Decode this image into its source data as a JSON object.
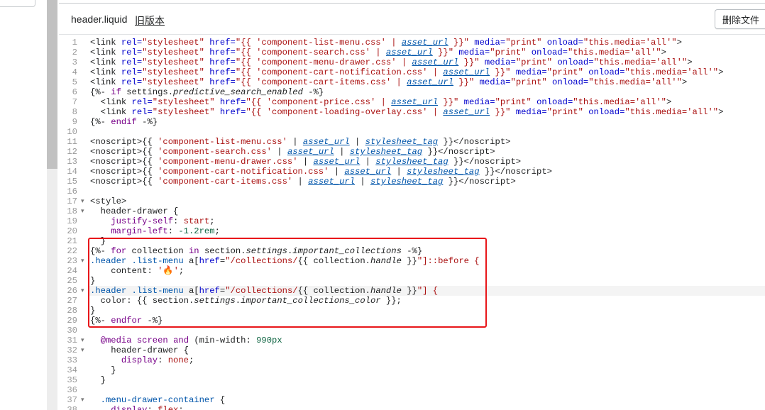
{
  "editor": {
    "file_name": "header.liquid",
    "old_version_link": "旧版本",
    "delete_button": "删除文件",
    "active_line": 26,
    "code_lines": [
      {
        "n": "1",
        "fold": "",
        "segs": [
          [
            "",
            "<link "
          ],
          [
            "t-attr",
            "rel="
          ],
          [
            "t-str",
            "\"stylesheet\""
          ],
          [
            "",
            " "
          ],
          [
            "t-attr",
            "href="
          ],
          [
            "t-str",
            "\"{{ 'component-list-menu.css' | "
          ],
          [
            "t-filter",
            "asset_url"
          ],
          [
            "t-str",
            " }}\""
          ],
          [
            "",
            " "
          ],
          [
            "t-attr",
            "media="
          ],
          [
            "t-str",
            "\"print\""
          ],
          [
            "",
            " "
          ],
          [
            "t-attr",
            "onload="
          ],
          [
            "t-str",
            "\"this.media='all'\""
          ],
          [
            "",
            ">"
          ]
        ]
      },
      {
        "n": "2",
        "fold": "",
        "segs": [
          [
            "",
            "<link "
          ],
          [
            "t-attr",
            "rel="
          ],
          [
            "t-str",
            "\"stylesheet\""
          ],
          [
            "",
            " "
          ],
          [
            "t-attr",
            "href="
          ],
          [
            "t-str",
            "\"{{ 'component-search.css' | "
          ],
          [
            "t-filter",
            "asset_url"
          ],
          [
            "t-str",
            " }}\""
          ],
          [
            "",
            " "
          ],
          [
            "t-attr",
            "media="
          ],
          [
            "t-str",
            "\"print\""
          ],
          [
            "",
            " "
          ],
          [
            "t-attr",
            "onload="
          ],
          [
            "t-str",
            "\"this.media='all'\""
          ],
          [
            "",
            ">"
          ]
        ]
      },
      {
        "n": "3",
        "fold": "",
        "segs": [
          [
            "",
            "<link "
          ],
          [
            "t-attr",
            "rel="
          ],
          [
            "t-str",
            "\"stylesheet\""
          ],
          [
            "",
            " "
          ],
          [
            "t-attr",
            "href="
          ],
          [
            "t-str",
            "\"{{ 'component-menu-drawer.css' | "
          ],
          [
            "t-filter",
            "asset_url"
          ],
          [
            "t-str",
            " }}\""
          ],
          [
            "",
            " "
          ],
          [
            "t-attr",
            "media="
          ],
          [
            "t-str",
            "\"print\""
          ],
          [
            "",
            " "
          ],
          [
            "t-attr",
            "onload="
          ],
          [
            "t-str",
            "\"this.media='all'\""
          ],
          [
            "",
            ">"
          ]
        ]
      },
      {
        "n": "4",
        "fold": "",
        "segs": [
          [
            "",
            "<link "
          ],
          [
            "t-attr",
            "rel="
          ],
          [
            "t-str",
            "\"stylesheet\""
          ],
          [
            "",
            " "
          ],
          [
            "t-attr",
            "href="
          ],
          [
            "t-str",
            "\"{{ 'component-cart-notification.css' | "
          ],
          [
            "t-filter",
            "asset_url"
          ],
          [
            "t-str",
            " }}\""
          ],
          [
            "",
            " "
          ],
          [
            "t-attr",
            "media="
          ],
          [
            "t-str",
            "\"print\""
          ],
          [
            "",
            " "
          ],
          [
            "t-attr",
            "onload="
          ],
          [
            "t-str",
            "\"this.media='all'\""
          ],
          [
            "",
            ">"
          ]
        ]
      },
      {
        "n": "5",
        "fold": "",
        "segs": [
          [
            "",
            "<link "
          ],
          [
            "t-attr",
            "rel="
          ],
          [
            "t-str",
            "\"stylesheet\""
          ],
          [
            "",
            " "
          ],
          [
            "t-attr",
            "href="
          ],
          [
            "t-str",
            "\"{{ 'component-cart-items.css' | "
          ],
          [
            "t-filter",
            "asset_url"
          ],
          [
            "t-str",
            " }}\""
          ],
          [
            "",
            " "
          ],
          [
            "t-attr",
            "media="
          ],
          [
            "t-str",
            "\"print\""
          ],
          [
            "",
            " "
          ],
          [
            "t-attr",
            "onload="
          ],
          [
            "t-str",
            "\"this.media='all'\""
          ],
          [
            "",
            ">"
          ]
        ]
      },
      {
        "n": "6",
        "fold": "",
        "segs": [
          [
            "",
            "{%- "
          ],
          [
            "t-kw",
            "if"
          ],
          [
            "",
            " settings."
          ],
          [
            "t-italic",
            "predictive_search_enabled"
          ],
          [
            "",
            " -%}"
          ]
        ]
      },
      {
        "n": "7",
        "fold": "",
        "segs": [
          [
            "",
            "  <link "
          ],
          [
            "t-attr",
            "rel="
          ],
          [
            "t-str",
            "\"stylesheet\""
          ],
          [
            "",
            " "
          ],
          [
            "t-attr",
            "href="
          ],
          [
            "t-str",
            "\"{{ 'component-price.css' | "
          ],
          [
            "t-filter",
            "asset_url"
          ],
          [
            "t-str",
            " }}\""
          ],
          [
            "",
            " "
          ],
          [
            "t-attr",
            "media="
          ],
          [
            "t-str",
            "\"print\""
          ],
          [
            "",
            " "
          ],
          [
            "t-attr",
            "onload="
          ],
          [
            "t-str",
            "\"this.media='all'\""
          ],
          [
            "",
            ">"
          ]
        ]
      },
      {
        "n": "8",
        "fold": "",
        "segs": [
          [
            "",
            "  <link "
          ],
          [
            "t-attr",
            "rel="
          ],
          [
            "t-str",
            "\"stylesheet\""
          ],
          [
            "",
            " "
          ],
          [
            "t-attr",
            "href="
          ],
          [
            "t-str",
            "\"{{ 'component-loading-overlay.css' | "
          ],
          [
            "t-filter",
            "asset_url"
          ],
          [
            "t-str",
            " }}\""
          ],
          [
            "",
            " "
          ],
          [
            "t-attr",
            "media="
          ],
          [
            "t-str",
            "\"print\""
          ],
          [
            "",
            " "
          ],
          [
            "t-attr",
            "onload="
          ],
          [
            "t-str",
            "\"this.media='all'\""
          ],
          [
            "",
            ">"
          ]
        ]
      },
      {
        "n": "9",
        "fold": "",
        "segs": [
          [
            "",
            "{%- "
          ],
          [
            "t-kw",
            "endif"
          ],
          [
            "",
            " -%}"
          ]
        ]
      },
      {
        "n": "10",
        "fold": "",
        "segs": [
          [
            "",
            ""
          ]
        ]
      },
      {
        "n": "11",
        "fold": "",
        "segs": [
          [
            "",
            "<noscript>{{ "
          ],
          [
            "t-str",
            "'component-list-menu.css'"
          ],
          [
            "",
            " | "
          ],
          [
            "t-filter",
            "asset_url"
          ],
          [
            "",
            " | "
          ],
          [
            "t-filter",
            "stylesheet_tag"
          ],
          [
            "",
            " }}</noscript>"
          ]
        ]
      },
      {
        "n": "12",
        "fold": "",
        "segs": [
          [
            "",
            "<noscript>{{ "
          ],
          [
            "t-str",
            "'component-search.css'"
          ],
          [
            "",
            " | "
          ],
          [
            "t-filter",
            "asset_url"
          ],
          [
            "",
            " | "
          ],
          [
            "t-filter",
            "stylesheet_tag"
          ],
          [
            "",
            " }}</noscript>"
          ]
        ]
      },
      {
        "n": "13",
        "fold": "",
        "segs": [
          [
            "",
            "<noscript>{{ "
          ],
          [
            "t-str",
            "'component-menu-drawer.css'"
          ],
          [
            "",
            " | "
          ],
          [
            "t-filter",
            "asset_url"
          ],
          [
            "",
            " | "
          ],
          [
            "t-filter",
            "stylesheet_tag"
          ],
          [
            "",
            " }}</noscript>"
          ]
        ]
      },
      {
        "n": "14",
        "fold": "",
        "segs": [
          [
            "",
            "<noscript>{{ "
          ],
          [
            "t-str",
            "'component-cart-notification.css'"
          ],
          [
            "",
            " | "
          ],
          [
            "t-filter",
            "asset_url"
          ],
          [
            "",
            " | "
          ],
          [
            "t-filter",
            "stylesheet_tag"
          ],
          [
            "",
            " }}</noscript>"
          ]
        ]
      },
      {
        "n": "15",
        "fold": "",
        "segs": [
          [
            "",
            "<noscript>{{ "
          ],
          [
            "t-str",
            "'component-cart-items.css'"
          ],
          [
            "",
            " | "
          ],
          [
            "t-filter",
            "asset_url"
          ],
          [
            "",
            " | "
          ],
          [
            "t-filter",
            "stylesheet_tag"
          ],
          [
            "",
            " }}</noscript>"
          ]
        ]
      },
      {
        "n": "16",
        "fold": "",
        "segs": [
          [
            "",
            ""
          ]
        ]
      },
      {
        "n": "17",
        "fold": "▾",
        "segs": [
          [
            "",
            "<style>"
          ]
        ]
      },
      {
        "n": "18",
        "fold": "▾",
        "segs": [
          [
            "",
            "  header-drawer {"
          ]
        ]
      },
      {
        "n": "19",
        "fold": "",
        "segs": [
          [
            "",
            "    "
          ],
          [
            "t-kw",
            "justify-self"
          ],
          [
            "",
            ": "
          ],
          [
            "t-val",
            "start"
          ],
          [
            "",
            ";"
          ]
        ]
      },
      {
        "n": "20",
        "fold": "",
        "segs": [
          [
            "",
            "    "
          ],
          [
            "t-kw",
            "margin-left"
          ],
          [
            "",
            ": "
          ],
          [
            "t-num",
            "-1.2rem"
          ],
          [
            "",
            ";"
          ]
        ]
      },
      {
        "n": "21",
        "fold": "",
        "segs": [
          [
            "",
            "  }"
          ]
        ]
      },
      {
        "n": "22",
        "fold": "",
        "segs": [
          [
            "",
            "{%- "
          ],
          [
            "t-kw",
            "for"
          ],
          [
            "",
            " collection "
          ],
          [
            "t-kw",
            "in"
          ],
          [
            "",
            " section."
          ],
          [
            "t-italic",
            "settings"
          ],
          [
            "",
            "."
          ],
          [
            "t-italic",
            "important_collections"
          ],
          [
            "",
            " -%}"
          ]
        ]
      },
      {
        "n": "23",
        "fold": "▾",
        "segs": [
          [
            "t-sel",
            ".header .list-menu "
          ],
          [
            "",
            "a["
          ],
          [
            "t-attr",
            "href"
          ],
          [
            "",
            "="
          ],
          [
            "t-str",
            "\"/collections/"
          ],
          [
            "",
            "{{ collection."
          ],
          [
            "t-italic",
            "handle"
          ],
          [
            "",
            " }}"
          ],
          [
            "t-str",
            "\"]::before {"
          ]
        ]
      },
      {
        "n": "24",
        "fold": "",
        "segs": [
          [
            "",
            "    content: "
          ],
          [
            "t-str",
            "'🔥'"
          ],
          [
            "",
            ";"
          ]
        ]
      },
      {
        "n": "25",
        "fold": "",
        "segs": [
          [
            "",
            "}"
          ]
        ]
      },
      {
        "n": "26",
        "fold": "▾",
        "segs": [
          [
            "t-sel",
            ".header .list-menu "
          ],
          [
            "",
            "a["
          ],
          [
            "t-attr",
            "href"
          ],
          [
            "",
            "="
          ],
          [
            "t-str",
            "\"/collections/"
          ],
          [
            "",
            "{{ collection."
          ],
          [
            "t-italic",
            "handle"
          ],
          [
            "",
            " }}"
          ],
          [
            "t-str",
            "\"] {"
          ]
        ]
      },
      {
        "n": "27",
        "fold": "",
        "segs": [
          [
            "",
            "  color: {{ section."
          ],
          [
            "t-italic",
            "settings"
          ],
          [
            "",
            "."
          ],
          [
            "t-italic",
            "important_collections_color"
          ],
          [
            "",
            " }};"
          ]
        ]
      },
      {
        "n": "28",
        "fold": "",
        "segs": [
          [
            "",
            "}"
          ]
        ]
      },
      {
        "n": "29",
        "fold": "",
        "segs": [
          [
            "",
            "{%- "
          ],
          [
            "t-kw",
            "endfor"
          ],
          [
            "",
            " -%}"
          ]
        ]
      },
      {
        "n": "30",
        "fold": "",
        "segs": [
          [
            "",
            ""
          ]
        ]
      },
      {
        "n": "31",
        "fold": "▾",
        "segs": [
          [
            "",
            "  "
          ],
          [
            "t-kw",
            "@media"
          ],
          [
            "",
            " "
          ],
          [
            "t-kw",
            "screen"
          ],
          [
            "",
            " "
          ],
          [
            "t-kw",
            "and"
          ],
          [
            "",
            " (min-width: "
          ],
          [
            "t-num",
            "990px"
          ],
          [
            ") {"
          ]
        ]
      },
      {
        "n": "32",
        "fold": "▾",
        "segs": [
          [
            "",
            "    header-drawer {"
          ]
        ]
      },
      {
        "n": "33",
        "fold": "",
        "segs": [
          [
            "",
            "      "
          ],
          [
            "t-kw",
            "display"
          ],
          [
            "",
            ": "
          ],
          [
            "t-val",
            "none"
          ],
          [
            "",
            ";"
          ]
        ]
      },
      {
        "n": "34",
        "fold": "",
        "segs": [
          [
            "",
            "    }"
          ]
        ]
      },
      {
        "n": "35",
        "fold": "",
        "segs": [
          [
            "",
            "  }"
          ]
        ]
      },
      {
        "n": "36",
        "fold": "",
        "segs": [
          [
            "",
            ""
          ]
        ]
      },
      {
        "n": "37",
        "fold": "▾",
        "segs": [
          [
            "",
            "  "
          ],
          [
            "t-sel",
            ".menu-drawer-container"
          ],
          [
            "",
            " {"
          ]
        ]
      },
      {
        "n": "38",
        "fold": "",
        "segs": [
          [
            "",
            "    "
          ],
          [
            "t-kw",
            "display"
          ],
          [
            "",
            ": "
          ],
          [
            "t-val",
            "flex"
          ],
          [
            "",
            ";"
          ]
        ]
      }
    ]
  }
}
